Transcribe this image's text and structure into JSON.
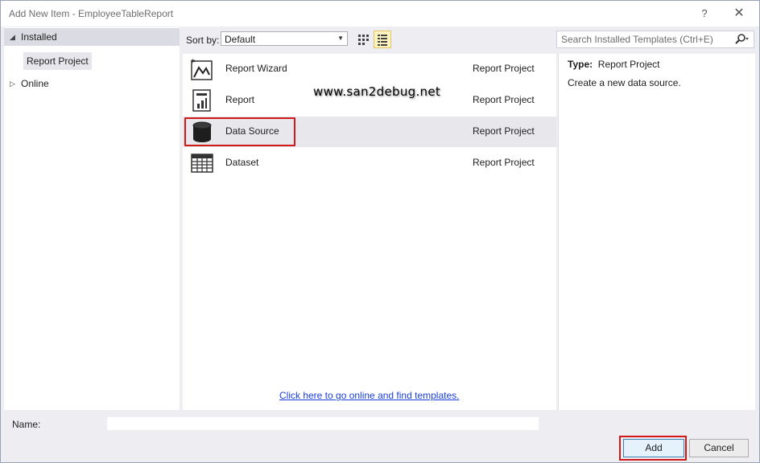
{
  "window": {
    "title": "Add New Item - EmployeeTableReport",
    "help": "?",
    "close": "✕"
  },
  "tree": {
    "installed": "Installed",
    "report_project": "Report Project",
    "online": "Online"
  },
  "toolbar": {
    "sort_label": "Sort by:",
    "sort_value": "Default"
  },
  "search": {
    "placeholder": "Search Installed Templates (Ctrl+E)"
  },
  "items": [
    {
      "name": "Report Wizard",
      "type": "Report Project"
    },
    {
      "name": "Report",
      "type": "Report Project"
    },
    {
      "name": "Data Source",
      "type": "Report Project"
    },
    {
      "name": "Dataset",
      "type": "Report Project"
    }
  ],
  "watermark": "www.san2debug.net",
  "online_link": "Click here to go online and find templates.",
  "details": {
    "type_label": "Type:",
    "type_value": "Report Project",
    "description": "Create a new data source."
  },
  "name_field": {
    "label": "Name:",
    "value": ""
  },
  "buttons": {
    "add": "Add",
    "cancel": "Cancel"
  }
}
